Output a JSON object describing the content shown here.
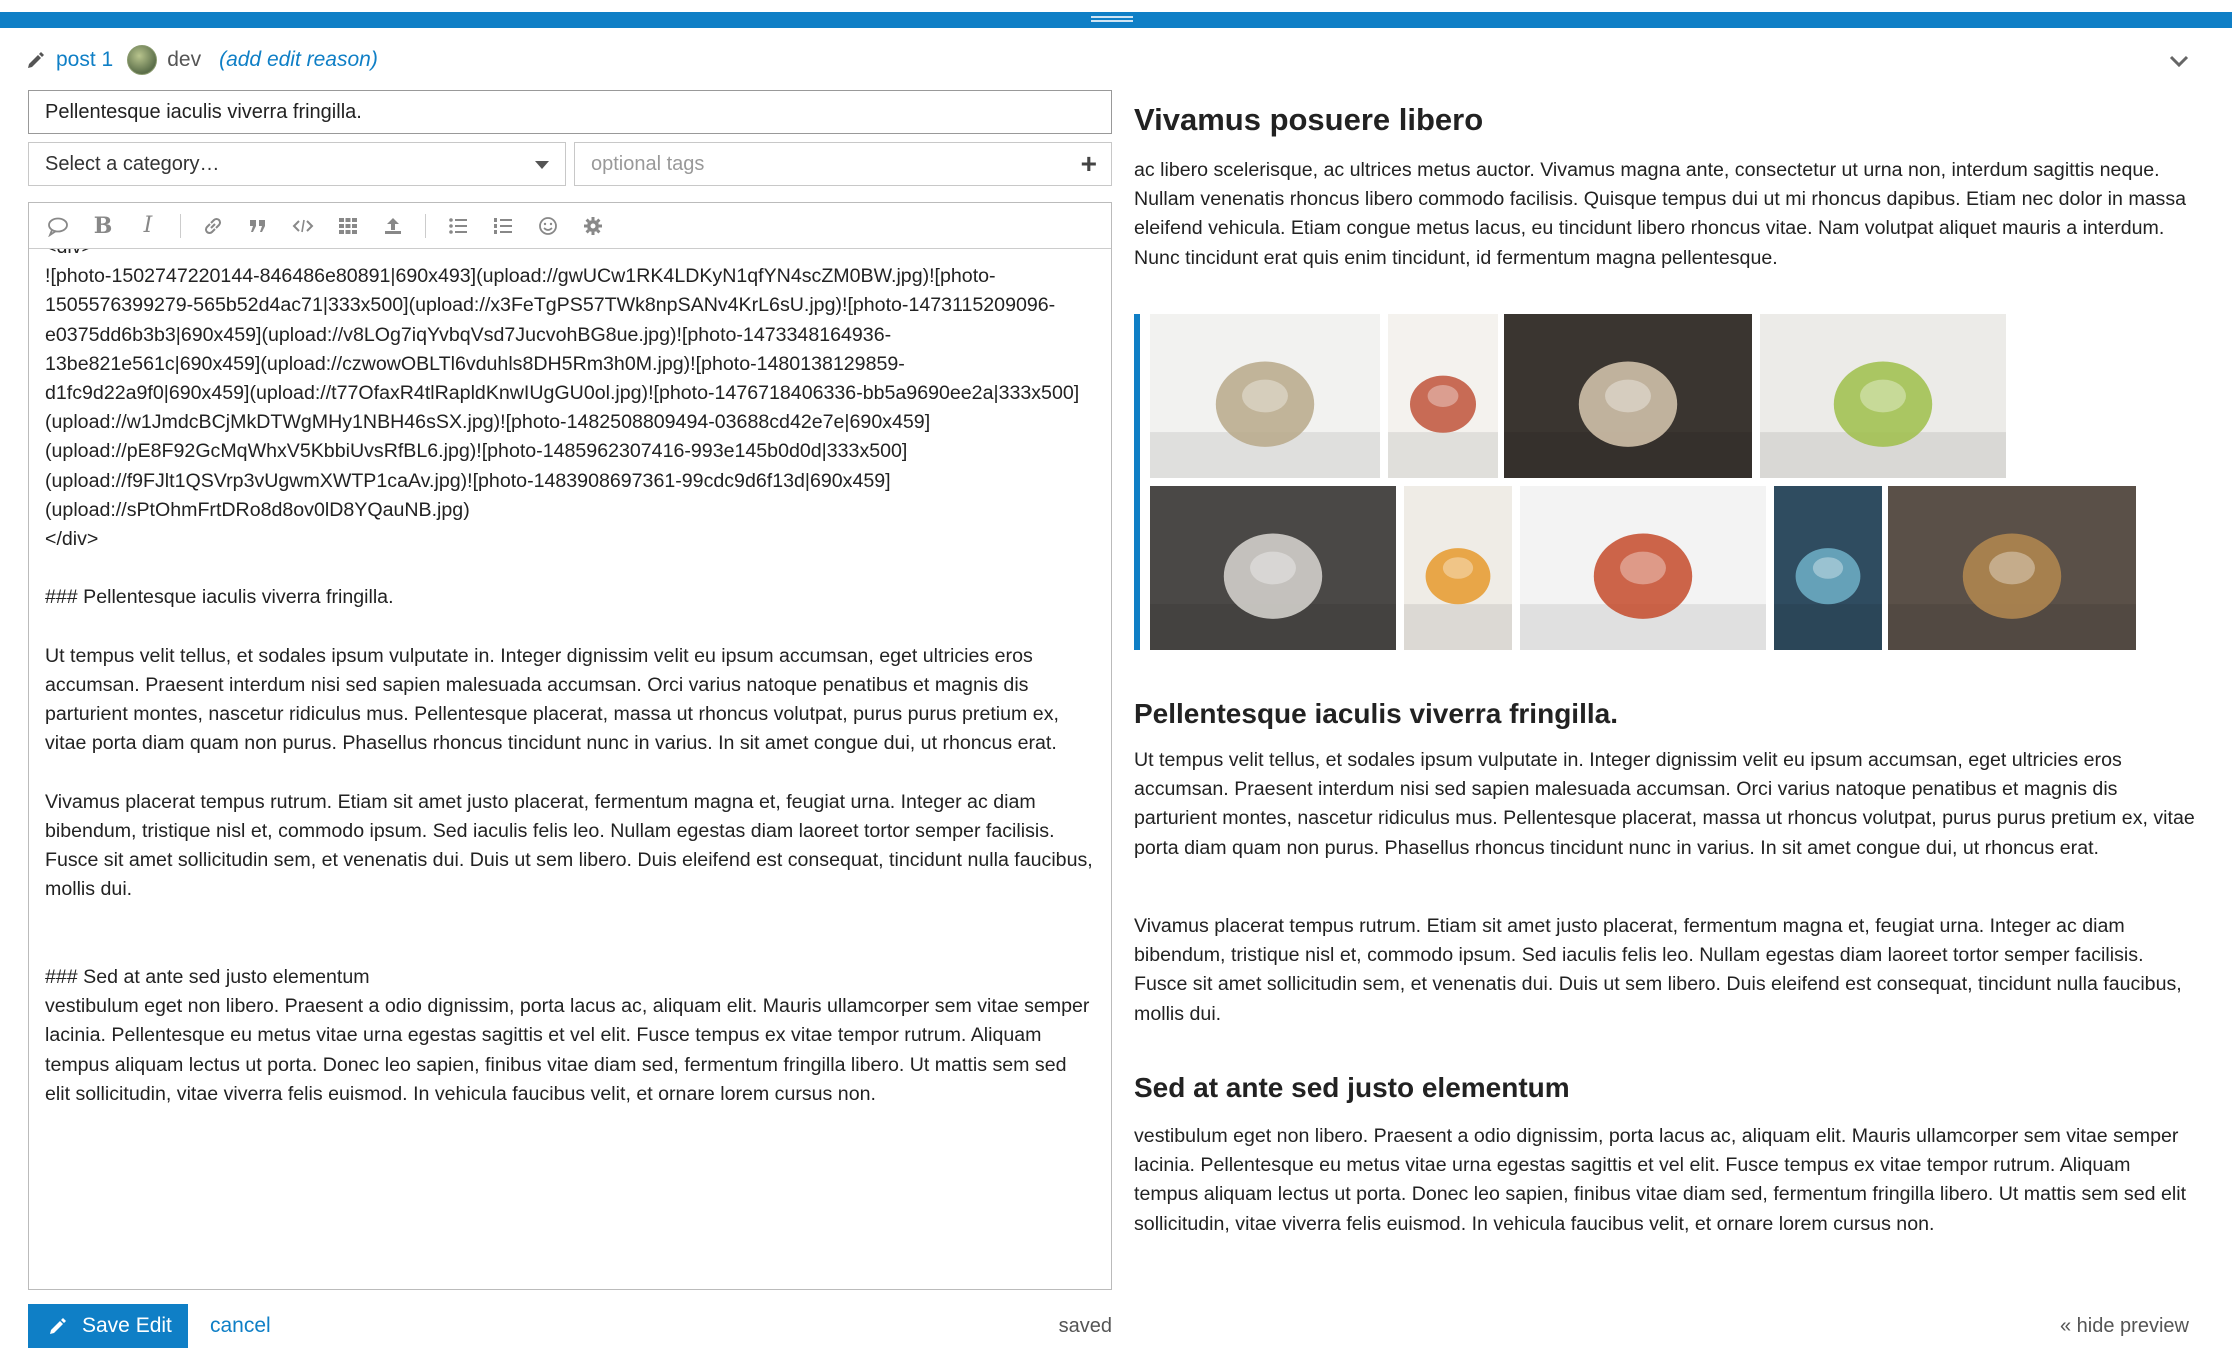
{
  "reply_header": {
    "post_label": "post 1",
    "username": "dev",
    "edit_reason": "(add edit reason)"
  },
  "composer": {
    "title_value": "Pellentesque iaculis viverra fringilla.",
    "category_placeholder": "Select a category…",
    "tags_placeholder": "optional tags",
    "toolbar_icons": [
      "quote-icon",
      "bold-icon",
      "italic-icon",
      "link-icon",
      "blockquote-icon",
      "code-icon",
      "table-icon",
      "upload-icon",
      "bullet-list-icon",
      "numbered-list-icon",
      "emoji-icon",
      "gear-icon"
    ],
    "toolbar_bold": "B",
    "toolbar_italic": "I"
  },
  "editor_lines": [
    "<div>",
    "![photo-1502747220144-846486e80891|690x493](upload://gwUCw1RK4LDKyN1qfYN4scZM0BW.jpg)![photo-1505576399279-565b52d4ac71|333x500](upload://x3FeTgPS57TWk8npSANv4KrL6sU.jpg)![photo-1473115209096-e0375dd6b3b3|690x459](upload://v8LOg7iqYvbqVsd7JucvohBG8ue.jpg)![photo-1473348164936-13be821e561c|690x459](upload://czwowOBLTl6vduhls8DH5Rm3h0M.jpg)![photo-1480138129859-d1fc9d22a9f0|690x459](upload://t77OfaxR4tlRapldKnwIUgGU0ol.jpg)![photo-1476718406336-bb5a9690ee2a|333x500](upload://w1JmdcBCjMkDTWgMHy1NBH46sSX.jpg)![photo-1482508809494-03688cd42e7e|690x459](upload://pE8F92GcMqWhxV5KbbiUvsRfBL6.jpg)![photo-1485962307416-993e145b0d0d|333x500](upload://f9FJlt1QSVrp3vUgwmXWTP1caAv.jpg)![photo-1483908697361-99cdc9d6f13d|690x459](upload://sPtOhmFrtDRo8d8ov0lD8YQauNB.jpg)",
    "</div>",
    "",
    "### Pellentesque iaculis viverra fringilla.",
    "",
    "Ut tempus velit tellus, et sodales ipsum vulputate in. Integer dignissim velit eu ipsum accumsan, eget ultricies eros accumsan. Praesent interdum nisi sed sapien malesuada accumsan. Orci varius natoque penatibus et magnis dis parturient montes, nascetur ridiculus mus. Pellentesque placerat, massa ut rhoncus volutpat, purus purus pretium ex, vitae porta diam quam non purus. Phasellus rhoncus tincidunt nunc in varius. In sit amet congue dui, ut rhoncus erat.",
    "",
    "Vivamus placerat tempus rutrum. Etiam sit amet justo placerat, fermentum magna et, feugiat urna. Integer ac diam bibendum, tristique nisl et, commodo ipsum. Sed iaculis felis leo. Nullam egestas diam laoreet tortor semper facilisis. Fusce sit amet sollicitudin sem, et venenatis dui. Duis ut sem libero. Duis eleifend est consequat, tincidunt nulla faucibus, mollis dui.",
    "",
    "",
    "### Sed at ante sed justo elementum",
    "vestibulum eget non libero. Praesent a odio dignissim, porta lacus ac, aliquam elit. Mauris ullamcorper sem vitae semper lacinia. Pellentesque eu metus vitae urna egestas sagittis et vel elit. Fusce tempus ex vitae tempor rutrum. Aliquam tempus aliquam lectus ut porta. Donec leo sapien, finibus vitae diam sed, fermentum fringilla libero. Ut mattis sem sed elit sollicitudin, vitae viverra felis euismod. In vehicula faucibus velit, et ornare lorem cursus non."
  ],
  "footer": {
    "save_label": "Save Edit",
    "cancel_label": "cancel",
    "status": "saved",
    "hide_preview": "« hide preview"
  },
  "preview": {
    "heading1": "Vivamus posuere libero",
    "para1": "ac libero scelerisque, ac ultrices metus auctor. Vivamus magna ante, consectetur ut urna non, interdum sagittis neque. Nullam venenatis rhoncus libero commodo facilisis. Quisque tempus dui ut mi rhoncus dapibus. Etiam nec dolor in massa eleifend vehicula. Etiam congue metus lacus, eu tincidunt libero rhoncus vitae. Nam volutpat aliquet mauris a interdum. Nunc tincidunt erat quis enim tincidunt, id fermentum magna pellentesque.",
    "heading2": "Pellentesque iaculis viverra fringilla.",
    "para2": "Ut tempus velit tellus, et sodales ipsum vulputate in. Integer dignissim velit eu ipsum accumsan, eget ultricies eros accumsan. Praesent interdum nisi sed sapien malesuada accumsan. Orci varius natoque penatibus et magnis dis parturient montes, nascetur ridiculus mus. Pellentesque placerat, massa ut rhoncus volutpat, purus purus pretium ex, vitae porta diam quam non purus. Phasellus rhoncus tincidunt nunc in varius. In sit amet congue dui, ut rhoncus erat.",
    "para3": "Vivamus placerat tempus rutrum. Etiam sit amet justo placerat, fermentum magna et, feugiat urna. Integer ac diam bibendum, tristique nisl et, commodo ipsum. Sed iaculis felis leo. Nullam egestas diam laoreet tortor semper facilisis. Fusce sit amet sollicitudin sem, et venenatis dui. Duis ut sem libero. Duis eleifend est consequat, tincidunt nulla faucibus, mollis dui.",
    "heading3": "Sed at ante sed justo elementum",
    "para4": "vestibulum eget non libero. Praesent a odio dignissim, porta lacus ac, aliquam elit. Mauris ullamcorper sem vitae semper lacinia. Pellentesque eu metus vitae urna egestas sagittis et vel elit. Fusce tempus ex vitae tempor rutrum. Aliquam tempus aliquam lectus ut porta. Donec leo sapien, finibus vitae diam sed, fermentum fringilla libero. Ut mattis sem sed elit sollicitudin, vitae viverra felis euismod. In vehicula faucibus velit, et ornare lorem cursus non."
  },
  "gallery_photos": [
    {
      "name": "granola-bowl-photo",
      "bg": "#f2f2f0",
      "accent": "#b9a98a"
    },
    {
      "name": "salad-jar-photo",
      "bg": "#f4f2ee",
      "accent": "#c0533a"
    },
    {
      "name": "smoothie-glass-photo",
      "bg": "#3a3530",
      "accent": "#d8c8b0"
    },
    {
      "name": "citrus-bottle-photo",
      "bg": "#ecebe8",
      "accent": "#9fbf4a"
    },
    {
      "name": "cookie-jar-photo",
      "bg": "#4a4846",
      "accent": "#d9d7d2"
    },
    {
      "name": "pumpkin-soup-photo",
      "bg": "#efece6",
      "accent": "#e69a2c"
    },
    {
      "name": "fruit-bowl-photo",
      "bg": "#f3f3f3",
      "accent": "#c44a2a"
    },
    {
      "name": "berry-tray-photo",
      "bg": "#2f4c60",
      "accent": "#6fb0c8"
    },
    {
      "name": "pastries-photo",
      "bg": "#5a5048",
      "accent": "#b48850"
    }
  ],
  "colors": {
    "accent": "#0f7fc6"
  }
}
